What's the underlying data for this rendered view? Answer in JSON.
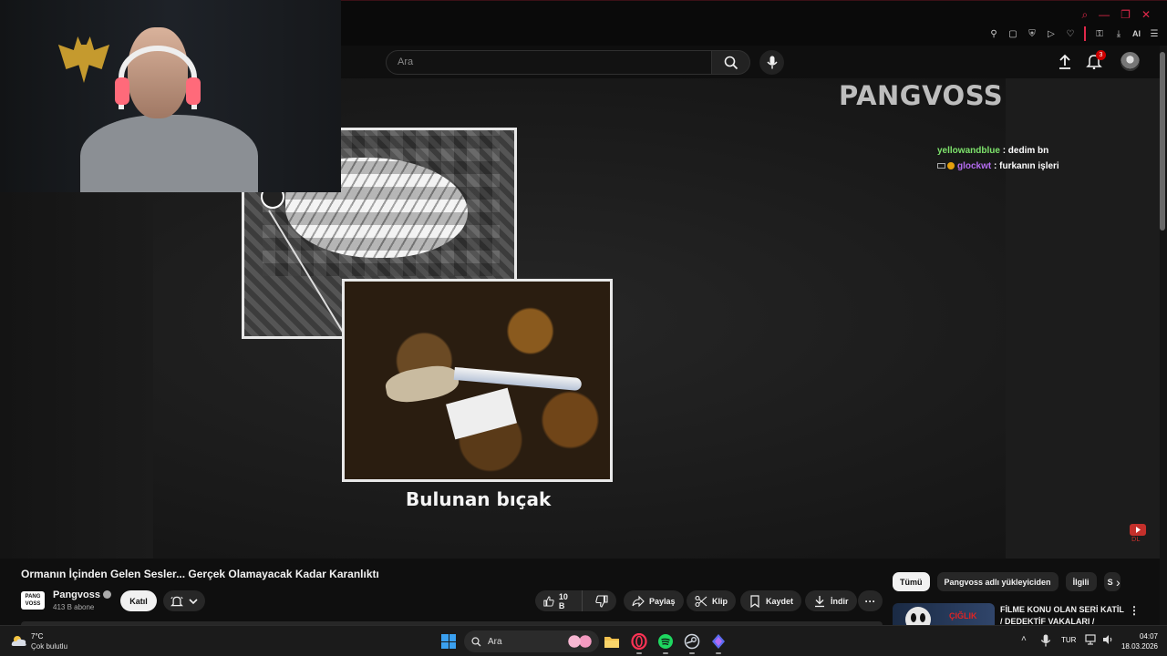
{
  "browser": {
    "extensions": [
      "pin-icon",
      "screenshot-icon",
      "shield-icon",
      "play-icon",
      "heart-icon",
      "lock-icon",
      "download-icon"
    ],
    "ai_label": "AI"
  },
  "header": {
    "search_placeholder": "Ara",
    "notification_count": "3"
  },
  "video": {
    "watermark": "PANGVOSS",
    "caption": "Bulunan bıçak",
    "chat": [
      {
        "user": "yellowandblue",
        "message": ": dedim bn"
      },
      {
        "user": "glockwt",
        "message": ": furkanın işleri"
      }
    ]
  },
  "info": {
    "title": "Ormanın İçinden Gelen Sesler... Gerçek Olamayacak Kadar Karanlıktı",
    "channel_logo": "PANG VOSS",
    "channel_name": "Pangvoss",
    "subscribers": "413 B abone",
    "join_label": "Katıl",
    "like_count": "10 B",
    "share_label": "Paylaş",
    "clip_label": "Klip",
    "save_label": "Kaydet",
    "download_label": "İndir"
  },
  "sidebar": {
    "chips": [
      "Tümü",
      "Pangvoss adlı yükleyiciden",
      "İlgili",
      "S"
    ],
    "rec_thumb_text": "ÇIĞLIK",
    "rec_title": "FİLME KONU OLAN SERİ KATİL / DEDEKTİF VAKALARI /"
  },
  "taskbar": {
    "temperature": "7°C",
    "condition": "Çok bulutlu",
    "search": "Ara",
    "language": "TUR",
    "time": "04:07",
    "date": "18.03.2026"
  },
  "colors": {
    "accent": "#e0284a",
    "background": "#0f0f0f",
    "chat_user1": "#7ee36c",
    "chat_user2": "#b56cf0"
  }
}
